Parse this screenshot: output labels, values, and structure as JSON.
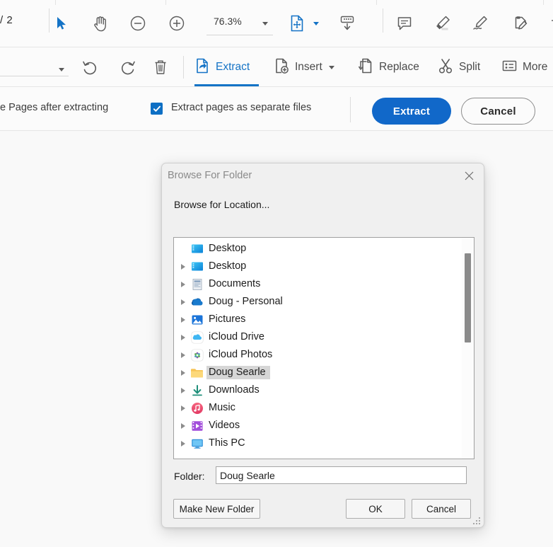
{
  "toolbar_top": {
    "page_indicator": "/ 2",
    "zoom_value": "76.3%",
    "icons": [
      {
        "name": "select-tool-icon",
        "label": "Select"
      },
      {
        "name": "hand-tool-icon",
        "label": "Pan"
      },
      {
        "name": "zoom-out-icon",
        "label": "Zoom Out"
      },
      {
        "name": "zoom-in-icon",
        "label": "Zoom In"
      },
      {
        "name": "zoom-dropdown-caret-icon",
        "label": "Zoom Presets"
      },
      {
        "name": "fit-page-icon",
        "label": "Fit Page"
      },
      {
        "name": "fit-page-caret-icon",
        "label": "Fit Options"
      },
      {
        "name": "scroll-mode-icon",
        "label": "Page Display"
      },
      {
        "name": "comment-icon",
        "label": "Comment"
      },
      {
        "name": "highlight-icon",
        "label": "Highlight"
      },
      {
        "name": "sign-icon",
        "label": "Sign"
      },
      {
        "name": "fill-and-sign-icon",
        "label": "Fill & Sign"
      }
    ]
  },
  "toolbar_tools": {
    "items": [
      {
        "label": "Extract",
        "icon": "extract-page-icon",
        "active": true,
        "caret": false
      },
      {
        "label": "Insert",
        "icon": "insert-page-icon",
        "active": false,
        "caret": true
      },
      {
        "label": "Replace",
        "icon": "replace-page-icon",
        "active": false,
        "caret": false
      },
      {
        "label": "Split",
        "icon": "scissors-icon",
        "active": false,
        "caret": false
      },
      {
        "label": "More",
        "icon": "more-list-icon",
        "active": false,
        "caret": false
      }
    ],
    "undo_label": "Undo",
    "redo_label": "Redo",
    "delete_label": "Delete"
  },
  "toolbar_options": {
    "delete_pages_label": "e Pages after extracting",
    "separate_files_label": "Extract pages as separate files",
    "separate_files_checked": true,
    "extract_button": "Extract",
    "cancel_button": "Cancel",
    "accent_color": "#1168c9"
  },
  "dialog": {
    "title": "Browse For Folder",
    "prompt": "Browse for Location...",
    "close_label": "Close",
    "folder_field_label": "Folder:",
    "folder_field_value": "Doug Searle",
    "buttons": {
      "make_new_folder": "Make New Folder",
      "ok": "OK",
      "cancel": "Cancel"
    },
    "tree": [
      {
        "label": "Desktop",
        "icon": "desktop-icon",
        "depth": 0,
        "expander": false,
        "selected": false
      },
      {
        "label": "Desktop",
        "icon": "desktop-icon",
        "depth": 1,
        "expander": true,
        "selected": false
      },
      {
        "label": "Documents",
        "icon": "documents-icon",
        "depth": 1,
        "expander": true,
        "selected": false
      },
      {
        "label": "Doug - Personal",
        "icon": "onedrive-cloud-icon",
        "depth": 1,
        "expander": true,
        "selected": false
      },
      {
        "label": "Pictures",
        "icon": "pictures-icon",
        "depth": 1,
        "expander": true,
        "selected": false
      },
      {
        "label": "iCloud Drive",
        "icon": "icloud-drive-icon",
        "depth": 1,
        "expander": true,
        "selected": false
      },
      {
        "label": "iCloud Photos",
        "icon": "icloud-photos-icon",
        "depth": 1,
        "expander": true,
        "selected": false
      },
      {
        "label": "Doug Searle",
        "icon": "folder-icon",
        "depth": 1,
        "expander": true,
        "selected": true
      },
      {
        "label": "Downloads",
        "icon": "downloads-icon",
        "depth": 1,
        "expander": true,
        "selected": false
      },
      {
        "label": "Music",
        "icon": "music-icon",
        "depth": 1,
        "expander": true,
        "selected": false
      },
      {
        "label": "Videos",
        "icon": "videos-icon",
        "depth": 1,
        "expander": true,
        "selected": false
      },
      {
        "label": "This PC",
        "icon": "this-pc-icon",
        "depth": 1,
        "expander": true,
        "selected": false
      }
    ]
  }
}
